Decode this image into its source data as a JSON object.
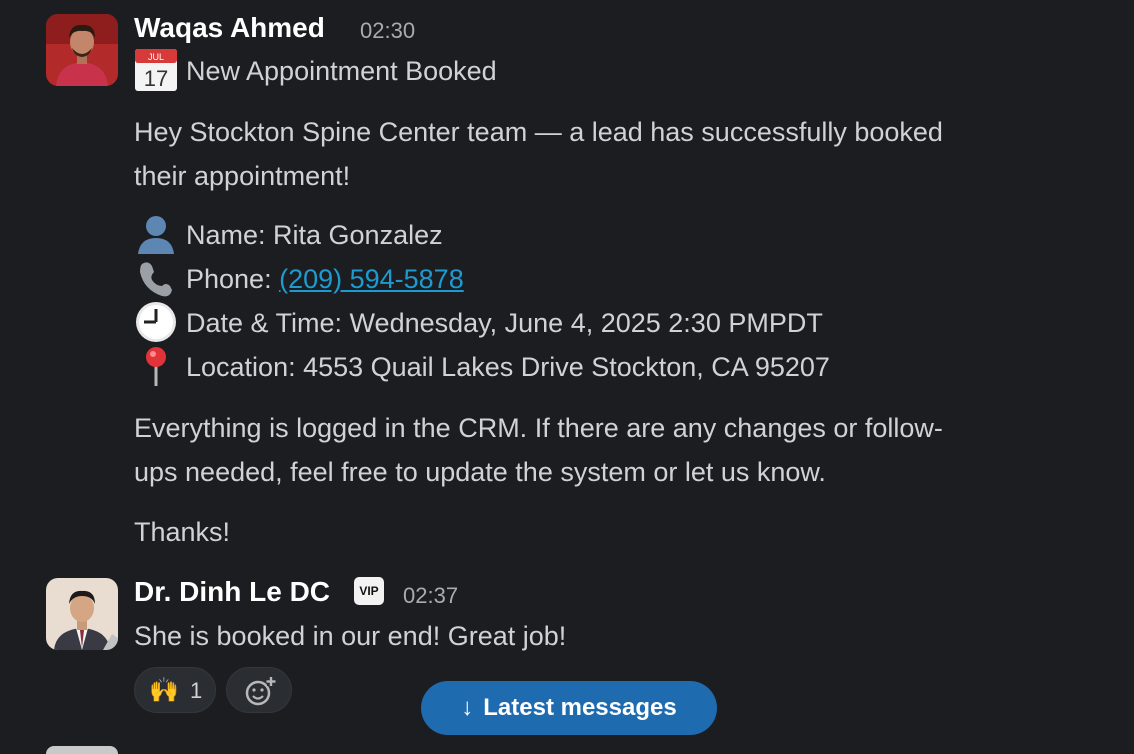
{
  "messages": [
    {
      "author": "Waqas Ahmed",
      "time": "02:30",
      "title_icon": "calendar-icon",
      "calendar_month": "JUL",
      "calendar_day": "17",
      "title": "New Appointment Booked",
      "intro_line1": "Hey Stockton Spine Center team — a lead has successfully booked",
      "intro_line2": "their appointment!",
      "details": [
        {
          "icon": "person-icon",
          "label": "Name: Rita Gonzalez"
        },
        {
          "icon": "phone-icon",
          "prefix": "Phone: ",
          "link": "(209) 594-5878"
        },
        {
          "icon": "clock-icon",
          "label": "Date & Time: Wednesday, June 4, 2025 2:30 PMPDT"
        },
        {
          "icon": "pin-icon",
          "label": "Location: 4553 Quail Lakes Drive Stockton, CA 95207"
        }
      ],
      "body_line1": "Everything is logged in the CRM. If there are any changes or follow-",
      "body_line2": "ups needed, feel free to update the system or let us know.",
      "sign_off": "Thanks!"
    },
    {
      "author": "Dr. Dinh Le DC",
      "badge": "VIP",
      "time": "02:37",
      "text": "She is booked in our end!  Great job!",
      "reaction_emoji": "🙌",
      "reaction_count": "1",
      "add_reaction_icon": "add-reaction-icon"
    }
  ],
  "latest_button": {
    "arrow": "↓",
    "label": "Latest messages"
  },
  "colors": {
    "background": "#1b1d21",
    "link": "#1d9bd1",
    "button": "#1f6bb0"
  }
}
